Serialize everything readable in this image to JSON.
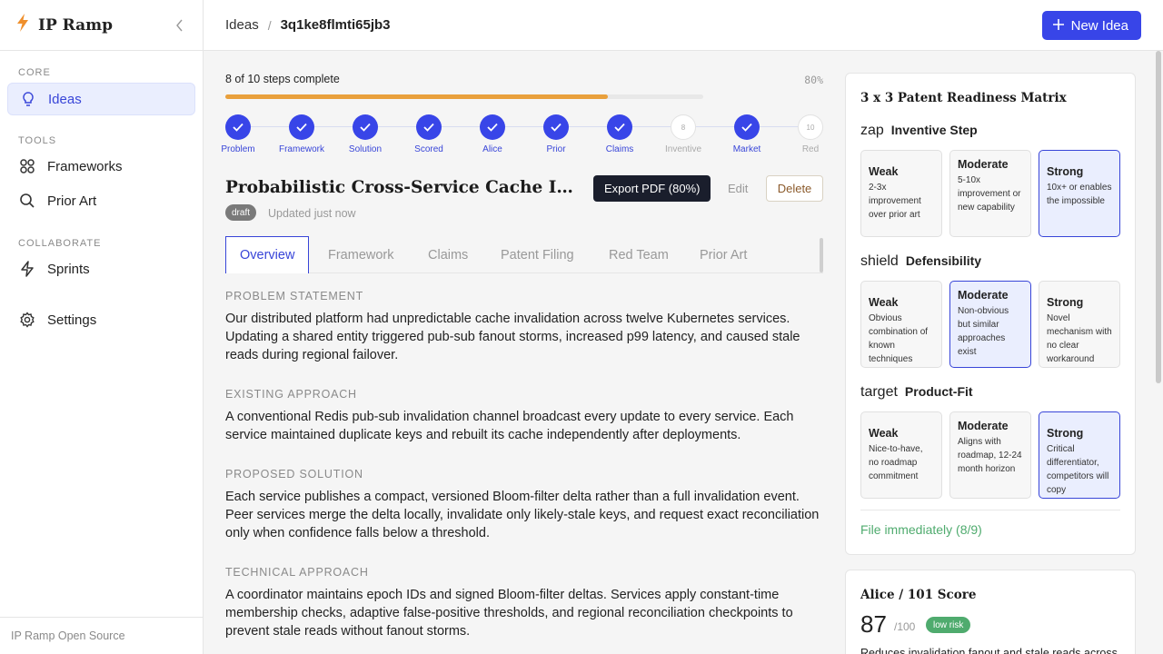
{
  "brand": {
    "name": "IP Ramp"
  },
  "sidebar": {
    "sections": [
      {
        "label": "CORE",
        "items": [
          {
            "label": "Ideas"
          }
        ]
      },
      {
        "label": "TOOLS",
        "items": [
          {
            "label": "Frameworks"
          },
          {
            "label": "Prior Art"
          }
        ]
      },
      {
        "label": "COLLABORATE",
        "items": [
          {
            "label": "Sprints"
          }
        ]
      }
    ],
    "settings_label": "Settings",
    "footer": "IP Ramp Open Source"
  },
  "topbar": {
    "crumb_root": "Ideas",
    "crumb_sep": "/",
    "crumb_id": "3q1ke8flmti65jb3",
    "new_idea_label": "New Idea"
  },
  "progress": {
    "text": "8 of 10 steps complete",
    "percent_label": "80%",
    "fraction": 0.8
  },
  "steps": [
    {
      "label": "Problem",
      "done": true
    },
    {
      "label": "Framework",
      "done": true
    },
    {
      "label": "Solution",
      "done": true
    },
    {
      "label": "Scored",
      "done": true
    },
    {
      "label": "Alice",
      "done": true
    },
    {
      "label": "Prior",
      "done": true
    },
    {
      "label": "Claims",
      "done": true
    },
    {
      "label": "Inventive",
      "done": false,
      "number": "8"
    },
    {
      "label": "Market",
      "done": true
    },
    {
      "label": "Red",
      "done": false,
      "number": "10"
    }
  ],
  "idea": {
    "title": "Probabilistic Cross-Service Cache Invalidation",
    "export_label": "Export PDF (80%)",
    "edit_label": "Edit",
    "delete_label": "Delete",
    "status": "draft",
    "updated": "Updated just now"
  },
  "tabs": [
    {
      "label": "Overview",
      "active": true
    },
    {
      "label": "Framework"
    },
    {
      "label": "Claims"
    },
    {
      "label": "Patent Filing"
    },
    {
      "label": "Red Team"
    },
    {
      "label": "Prior Art"
    }
  ],
  "sections": [
    {
      "heading": "PROBLEM STATEMENT",
      "body": "Our distributed platform had unpredictable cache invalidation across twelve Kubernetes services. Updating a shared entity triggered pub-sub fanout storms, increased p99 latency, and caused stale reads during regional failover."
    },
    {
      "heading": "EXISTING APPROACH",
      "body": "A conventional Redis pub-sub invalidation channel broadcast every update to every service. Each service maintained duplicate keys and rebuilt its cache independently after deployments."
    },
    {
      "heading": "PROPOSED SOLUTION",
      "body": "Each service publishes a compact, versioned Bloom-filter delta rather than a full invalidation event. Peer services merge the delta locally, invalidate only likely-stale keys, and request exact reconciliation only when confidence falls below a threshold."
    },
    {
      "heading": "TECHNICAL APPROACH",
      "body": "A coordinator maintains epoch IDs and signed Bloom-filter deltas. Services apply constant-time membership checks, adaptive false-positive thresholds, and regional reconciliation checkpoints to prevent stale reads without fanout storms."
    }
  ],
  "matrix": {
    "title": "3 x 3 Patent Readiness Matrix",
    "criteria": [
      {
        "icon": "zap",
        "name": "Inventive Step",
        "selected": 2,
        "options": [
          {
            "title": "Weak",
            "desc": "2-3x improvement over prior art"
          },
          {
            "title": "Moderate",
            "desc": "5-10x improvement or new capability"
          },
          {
            "title": "Strong",
            "desc": "10x+ or enables the impossible"
          }
        ]
      },
      {
        "icon": "shield",
        "name": "Defensibility",
        "selected": 1,
        "options": [
          {
            "title": "Weak",
            "desc": "Obvious combination of known techniques"
          },
          {
            "title": "Moderate",
            "desc": "Non-obvious but similar approaches exist"
          },
          {
            "title": "Strong",
            "desc": "Novel mechanism with no clear workaround"
          }
        ]
      },
      {
        "icon": "target",
        "name": "Product-Fit",
        "selected": 2,
        "options": [
          {
            "title": "Weak",
            "desc": "Nice-to-have, no roadmap commitment"
          },
          {
            "title": "Moderate",
            "desc": "Aligns with roadmap, 12-24 month horizon"
          },
          {
            "title": "Strong",
            "desc": "Critical differentiator, competitors will copy"
          }
        ]
      }
    ],
    "verdict": "File immediately (8/9)"
  },
  "alice": {
    "title": "Alice / 101 Score",
    "score": "87",
    "denominator": "/100",
    "risk": "low risk",
    "desc": "Reduces invalidation fanout and stale reads across"
  },
  "colors": {
    "accent": "#3845e8",
    "progress": "#e9a03c",
    "success": "#4fab6e"
  }
}
